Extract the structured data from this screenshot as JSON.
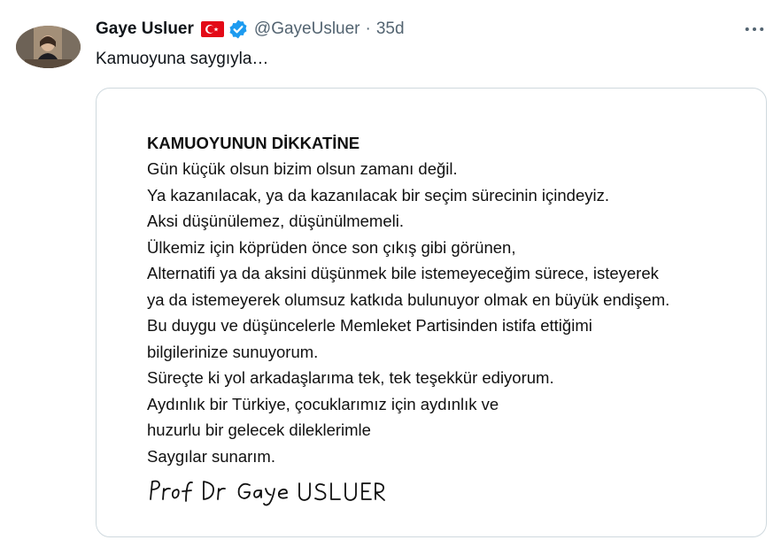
{
  "tweet": {
    "author_name": "Gaye Usluer",
    "handle": "@GayeUsluer",
    "separator": "·",
    "time": "35d",
    "text": "Kamuoyuna saygıyla…",
    "flag_icon": "turkey-flag-icon",
    "verified_icon": "verified-badge-icon",
    "more_icon": "more-options-icon",
    "verified_color": "#1d9bf0",
    "flag_color": "#e30a17"
  },
  "letter": {
    "title": "KAMUOYUNUN DİKKATİNE",
    "lines": [
      "Gün küçük olsun bizim olsun zamanı değil.",
      "Ya kazanılacak, ya da kazanılacak bir seçim sürecinin içindeyiz.",
      "Aksi düşünülemez, düşünülmemeli.",
      "Ülkemiz için köprüden önce son çıkış gibi görünen,",
      "Alternatifi ya da aksini düşünmek bile istemeyeceğim sürece, isteyerek",
      "ya da istemeyerek olumsuz katkıda bulunuyor olmak en büyük endişem.",
      "Bu duygu ve düşüncelerle Memleket Partisinden istifa ettiğimi",
      "bilgilerinize sunuyorum.",
      "Süreçte ki yol arkadaşlarıma  tek, tek teşekkür ediyorum.",
      "Aydınlık bir Türkiye, çocuklarımız için aydınlık ve",
      "huzurlu bir gelecek dileklerimle",
      "Saygılar sunarım."
    ],
    "signature": "Prof Dr Gaye USLUER"
  }
}
